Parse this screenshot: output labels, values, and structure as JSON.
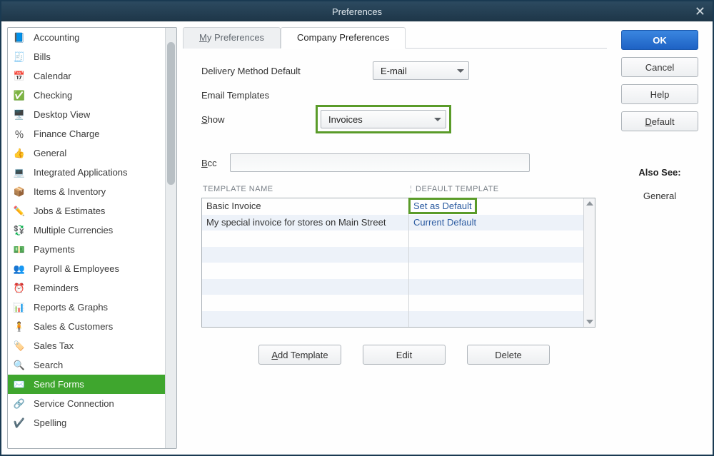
{
  "window": {
    "title": "Preferences"
  },
  "sidebar": {
    "items": [
      {
        "label": "Accounting",
        "selected": false,
        "icon": "book-icon"
      },
      {
        "label": "Bills",
        "selected": false,
        "icon": "bills-icon"
      },
      {
        "label": "Calendar",
        "selected": false,
        "icon": "calendar-icon"
      },
      {
        "label": "Checking",
        "selected": false,
        "icon": "check-icon"
      },
      {
        "label": "Desktop View",
        "selected": false,
        "icon": "desktop-icon"
      },
      {
        "label": "Finance Charge",
        "selected": false,
        "icon": "percent-icon"
      },
      {
        "label": "General",
        "selected": false,
        "icon": "thumb-icon"
      },
      {
        "label": "Integrated Applications",
        "selected": false,
        "icon": "pc-icon"
      },
      {
        "label": "Items & Inventory",
        "selected": false,
        "icon": "inventory-icon"
      },
      {
        "label": "Jobs & Estimates",
        "selected": false,
        "icon": "pencil-icon"
      },
      {
        "label": "Multiple Currencies",
        "selected": false,
        "icon": "currency-icon"
      },
      {
        "label": "Payments",
        "selected": false,
        "icon": "payment-icon"
      },
      {
        "label": "Payroll & Employees",
        "selected": false,
        "icon": "payroll-icon"
      },
      {
        "label": "Reminders",
        "selected": false,
        "icon": "clock-icon"
      },
      {
        "label": "Reports & Graphs",
        "selected": false,
        "icon": "chart-icon"
      },
      {
        "label": "Sales & Customers",
        "selected": false,
        "icon": "customers-icon"
      },
      {
        "label": "Sales Tax",
        "selected": false,
        "icon": "tax-icon"
      },
      {
        "label": "Search",
        "selected": false,
        "icon": "search-icon"
      },
      {
        "label": "Send Forms",
        "selected": true,
        "icon": "send-icon"
      },
      {
        "label": "Service Connection",
        "selected": false,
        "icon": "connection-icon"
      },
      {
        "label": "Spelling",
        "selected": false,
        "icon": "spelling-icon"
      }
    ]
  },
  "tabs": {
    "my_prefs_prefix": "M",
    "my_prefs_rest": "y Preferences",
    "company_prefs": "Company Preferences",
    "active": "company"
  },
  "form": {
    "delivery_label": "Delivery Method Default",
    "delivery_value": "E-mail",
    "email_templates_label": "Email Templates",
    "show_label_prefix": "S",
    "show_label_rest": "how",
    "show_value": "Invoices",
    "bcc_label_prefix": "B",
    "bcc_label_rest": "cc",
    "bcc_value": ""
  },
  "table": {
    "header_name": "TEMPLATE NAME",
    "header_default": "DEFAULT TEMPLATE",
    "rows": [
      {
        "name": "Basic Invoice",
        "default_label": "Set as Default",
        "highlight": true
      },
      {
        "name": "My special invoice for stores on Main Street",
        "default_label": "Current Default",
        "highlight": false
      }
    ]
  },
  "buttons": {
    "add_prefix": "A",
    "add_rest": "dd Template",
    "edit": "Edit",
    "delete": "Delete"
  },
  "right": {
    "ok": "OK",
    "cancel": "Cancel",
    "help": "Help",
    "default_prefix": "D",
    "default_rest": "efault",
    "also_see_header": "Also See:",
    "also_see_link": "General"
  },
  "icon_glyphs": {
    "book-icon": "📘",
    "bills-icon": "🧾",
    "calendar-icon": "📅",
    "check-icon": "✅",
    "desktop-icon": "🖥️",
    "percent-icon": "％",
    "thumb-icon": "👍",
    "pc-icon": "💻",
    "inventory-icon": "📦",
    "pencil-icon": "✏️",
    "currency-icon": "💱",
    "payment-icon": "💵",
    "payroll-icon": "👥",
    "clock-icon": "⏰",
    "chart-icon": "📊",
    "customers-icon": "🧍",
    "tax-icon": "🏷️",
    "search-icon": "🔍",
    "send-icon": "✉️",
    "connection-icon": "🔗",
    "spelling-icon": "✔️"
  }
}
